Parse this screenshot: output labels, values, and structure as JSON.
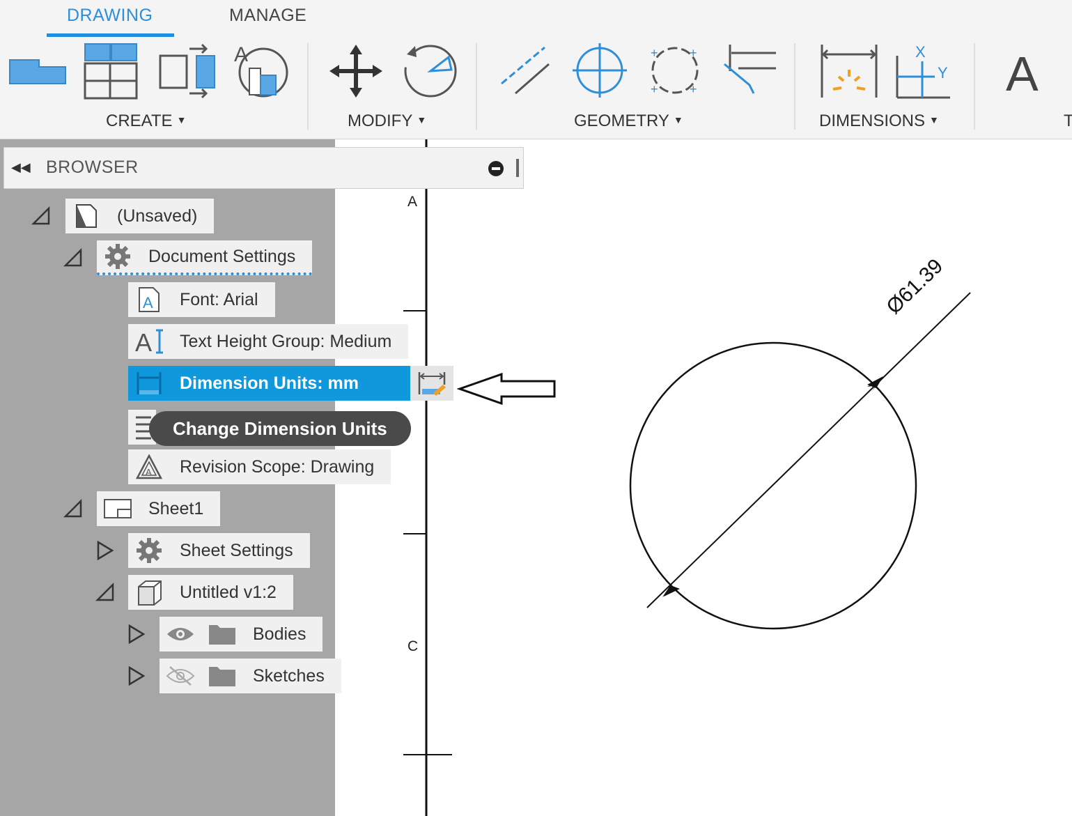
{
  "toolbar": {
    "tabs": [
      {
        "label": "DRAWING",
        "active": true
      },
      {
        "label": "MANAGE",
        "active": false
      }
    ],
    "groups": {
      "create": "CREATE",
      "modify": "MODIFY",
      "geometry": "GEOMETRY",
      "dimensions": "DIMENSIONS",
      "text_partial": "T"
    },
    "text_tool_glyph": "A",
    "accent_color": "#1e8ee0"
  },
  "browser": {
    "title": "BROWSER",
    "tree": {
      "root": "(Unsaved)",
      "document_settings": "Document Settings",
      "font": "Font: Arial",
      "text_height": "Text Height Group: Medium",
      "dimension_units": "Dimension Units: mm",
      "revision_scope": "Revision Scope: Drawing",
      "sheet": "Sheet1",
      "sheet_settings": "Sheet Settings",
      "view": "Untitled v1:2",
      "bodies": "Bodies",
      "sketches": "Sketches"
    },
    "tooltip": "Change Dimension Units",
    "selection_color": "#0f98dc"
  },
  "canvas": {
    "zone_labels": [
      "A",
      "C"
    ],
    "dimension_text": "Ø61.39"
  }
}
